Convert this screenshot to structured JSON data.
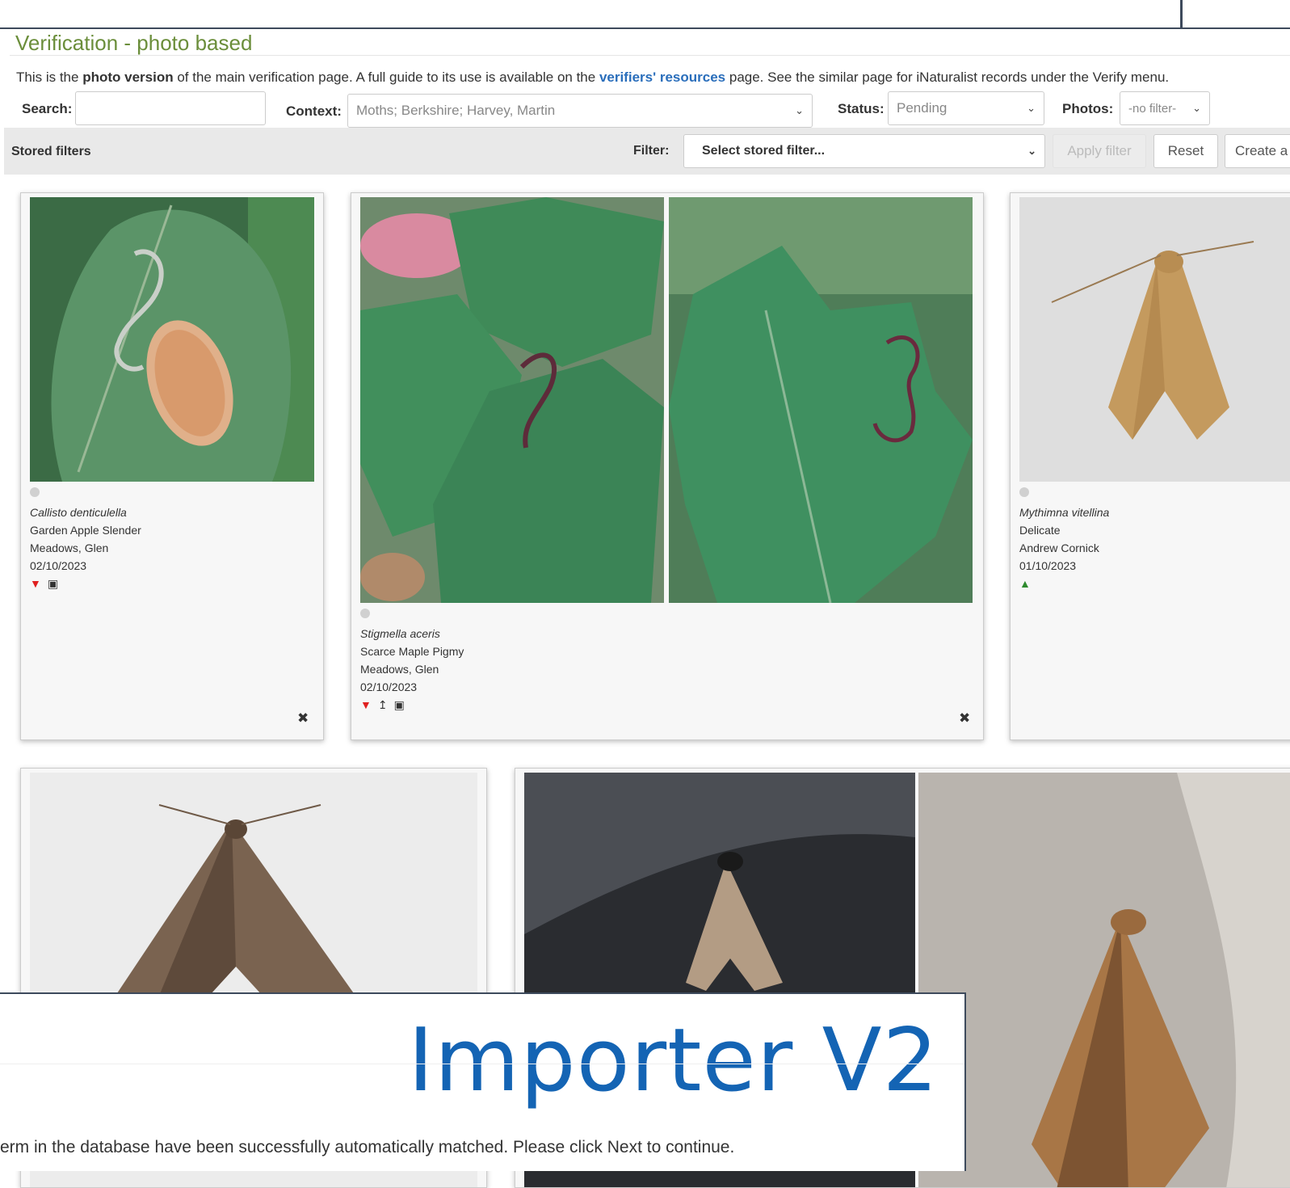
{
  "page": {
    "title": "Verification - photo based",
    "intro": {
      "part1": "This is the ",
      "bold": "photo version",
      "part2": " of the main verification page. A full guide to its use is available on the ",
      "link": "verifiers' resources",
      "part3": " page. See the similar page for iNaturalist records under the Verify menu."
    }
  },
  "controls": {
    "search_label": "Search:",
    "search_value": "",
    "context_label": "Context:",
    "context_value": "Moths; Berkshire; Harvey, Martin",
    "status_label": "Status:",
    "status_value": "Pending",
    "photos_label": "Photos:",
    "photos_value": "-no filter-"
  },
  "filterbar": {
    "stored_label": "Stored filters",
    "filter_label": "Filter:",
    "filter_select": "Select stored filter...",
    "apply_button": "Apply filter",
    "reset_button": "Reset",
    "create_button": "Create a"
  },
  "cards": [
    {
      "scientific": "Callisto denticulella",
      "common": "Garden Apple Slender",
      "recorder": "Meadows, Glen",
      "date": "02/10/2023",
      "status": "thumb-down-icon"
    },
    {
      "scientific": "Stigmella aceris",
      "common": "Scarce Maple Pigmy",
      "recorder": "Meadows, Glen",
      "date": "02/10/2023",
      "status": "thumb-down-icon"
    },
    {
      "scientific": "Mythimna vitellina",
      "common": "Delicate",
      "recorder": "Andrew Cornick",
      "date": "01/10/2023",
      "status": "thumb-up-icon"
    }
  ],
  "importer": {
    "title": "Importer V2",
    "message": "erm in the database have been successfully automatically matched. Please click Next to continue."
  },
  "colors": {
    "title_green": "#6b8e3b",
    "link_blue": "#2a6ebb",
    "importer_blue": "#1464b4",
    "thumb_red": "#e02020",
    "thumb_green": "#2e8b2e"
  }
}
